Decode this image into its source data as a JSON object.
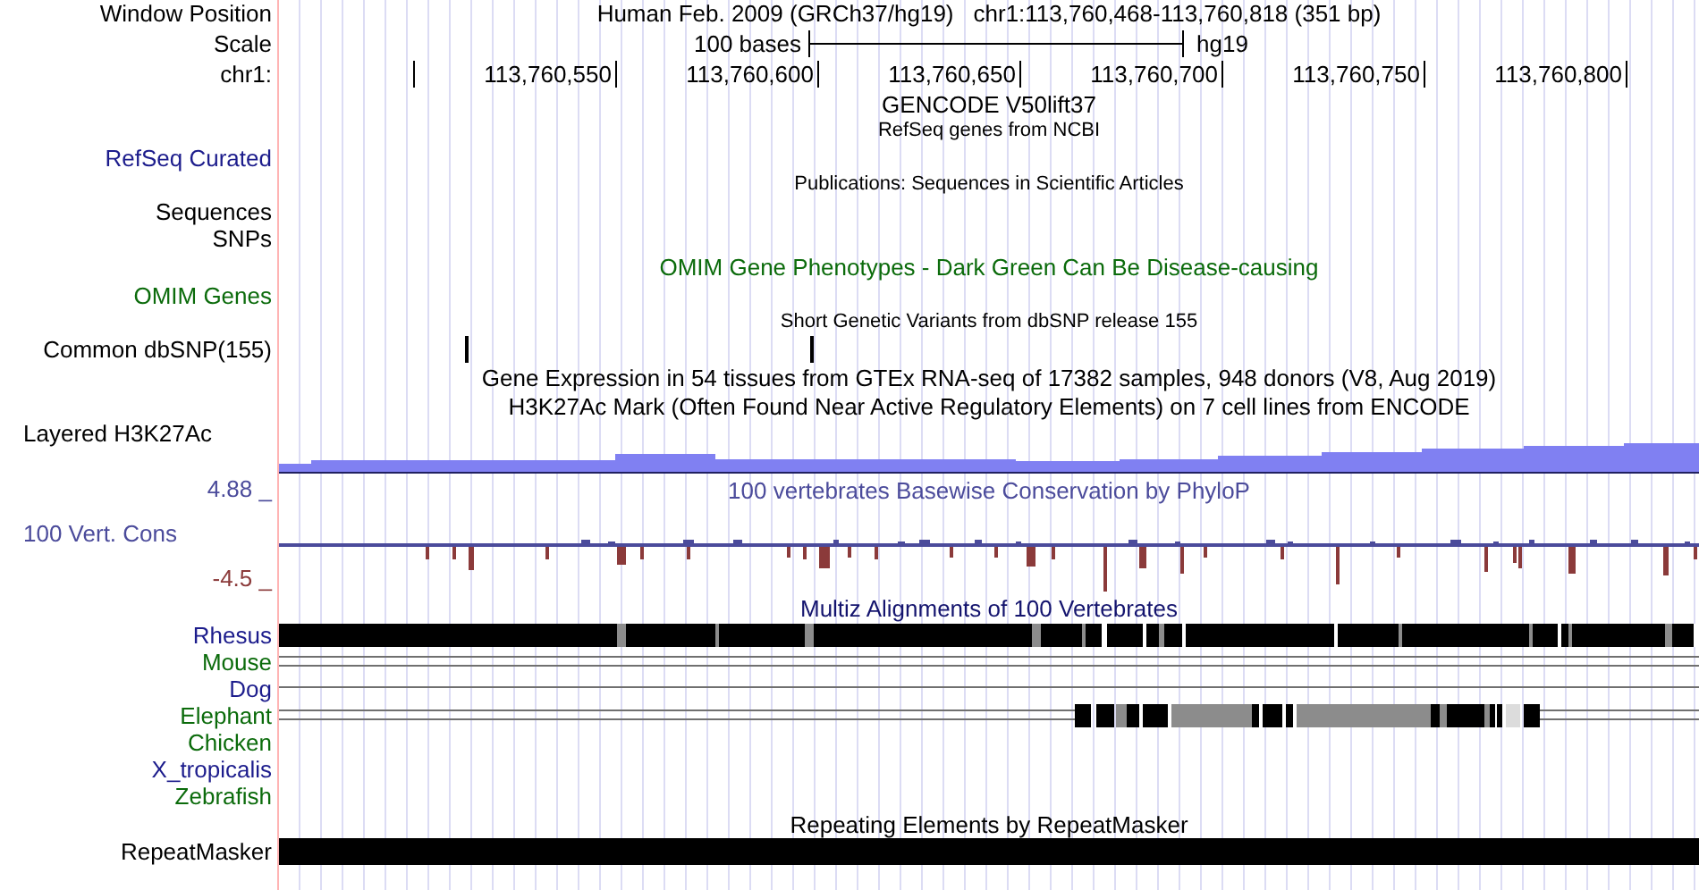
{
  "position": {
    "label": "Window Position",
    "assembly": "Human Feb. 2009 (GRCh37/hg19)",
    "range": "chr1:113,760,468-113,760,818 (351 bp)"
  },
  "scale": {
    "label": "Scale",
    "length": "100 bases",
    "assembly": "hg19"
  },
  "ruler": {
    "label": "chr1:",
    "ticks": [
      "113,760,550",
      "113,760,600",
      "113,760,650",
      "113,760,700",
      "113,760,750",
      "113,760,800"
    ]
  },
  "tracks": [
    {
      "kind": "title",
      "title": "GENCODE V50lift37",
      "color": "#000000"
    },
    {
      "kind": "note",
      "title": "RefSeq genes from NCBI",
      "color": "#000000"
    },
    {
      "kind": "label",
      "label": "RefSeq Curated",
      "color": "#1c1c8c"
    },
    {
      "kind": "note",
      "title": "Publications: Sequences in Scientific Articles",
      "color": "#000000"
    },
    {
      "kind": "label",
      "label": "Sequences",
      "color": "#000000"
    },
    {
      "kind": "label",
      "label": "SNPs",
      "color": "#000000"
    },
    {
      "kind": "title",
      "title": "OMIM Gene Phenotypes - Dark Green Can Be Disease-causing",
      "color": "#0b6b0b"
    },
    {
      "kind": "label",
      "label": "OMIM Genes",
      "color": "#0b6b0b"
    },
    {
      "kind": "note",
      "title": "Short Genetic Variants from dbSNP release 155",
      "color": "#000000"
    },
    {
      "kind": "snp",
      "label": "Common dbSNP(155)",
      "color": "#000000"
    },
    {
      "kind": "title",
      "title": "Gene Expression in 54 tissues from GTEx RNA-seq of 17382 samples, 948 donors (V8, Aug 2019)",
      "color": "#000000"
    },
    {
      "kind": "title",
      "title": "H3K27Ac Mark (Often Found Near Active Regulatory Elements) on 7 cell lines from ENCODE",
      "color": "#000000"
    },
    {
      "kind": "density",
      "label": "Layered H3K27Ac",
      "color": "#000000"
    },
    {
      "kind": "wiggle",
      "title": "100 vertebrates Basewise Conservation by PhyloP",
      "label": "100 Vert. Cons",
      "max": "4.88 _",
      "color": "#4b4b9b",
      "min": {
        "text": "-4.5 _",
        "color": "#8b3a3a"
      }
    },
    {
      "kind": "title",
      "title": "Multiz Alignments of 100 Vertebrates",
      "color": "#14146e"
    },
    {
      "kind": "blocks",
      "label": "Rhesus",
      "color": "#1c1c8c"
    },
    {
      "kind": "double",
      "label": "Mouse",
      "color": "#0b6b0b"
    },
    {
      "kind": "single",
      "label": "Dog",
      "color": "#1c1c8c"
    },
    {
      "kind": "partial",
      "label": "Elephant",
      "color": "#0b6b0b"
    },
    {
      "kind": "empty",
      "label": "Chicken",
      "color": "#0b6b0b"
    },
    {
      "kind": "empty",
      "label": "X_tropicalis",
      "color": "#1c1c8c"
    },
    {
      "kind": "empty",
      "label": "Zebrafish",
      "color": "#0b6b0b"
    },
    {
      "kind": "title",
      "title": "Repeating Elements by RepeatMasker",
      "color": "#000000"
    },
    {
      "kind": "repeat",
      "label": "RepeatMasker",
      "color": "#000000"
    }
  ]
}
